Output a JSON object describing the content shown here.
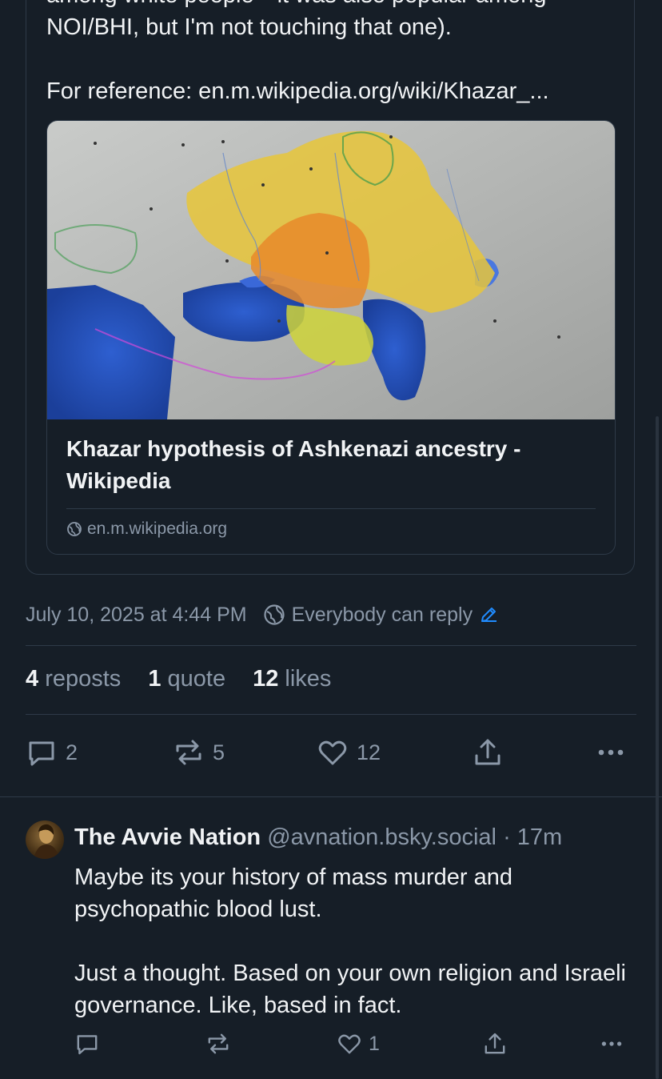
{
  "quote_post": {
    "clipped_line": "among white people—it was also popular among",
    "line1": "NOI/BHI, but I'm not touching that one).",
    "line2": "For reference: en.m.wikipedia.org/wiki/Khazar_...",
    "link_card": {
      "image_alt": "Map of the Khazar Khaganate",
      "title": "Khazar hypothesis of Ashkenazi ancestry - Wikipedia",
      "domain": "en.m.wikipedia.org"
    }
  },
  "meta": {
    "timestamp": "July 10, 2025 at 4:44 PM",
    "reply_setting": "Everybody can reply"
  },
  "stats": {
    "reposts_count": "4",
    "reposts_label": "reposts",
    "quotes_count": "1",
    "quotes_label": "quote",
    "likes_count": "12",
    "likes_label": "likes"
  },
  "actions": {
    "reply_count": "2",
    "repost_count": "5",
    "like_count": "12"
  },
  "reply": {
    "display_name": "The Avvie Nation",
    "handle": "@avnation.bsky.social",
    "time": "· 17m",
    "paragraph1": "Maybe its your history of mass murder and psychopathic blood lust.",
    "paragraph2": "Just a thought. Based on your own religion and Israeli governance. Like, based in fact.",
    "like_count": "1"
  },
  "colors": {
    "background": "#161e27",
    "border": "#2e3a48",
    "muted_text": "#8b98a8",
    "accent": "#208bfe"
  },
  "icons": [
    "globe-icon",
    "pencil-icon",
    "reply-icon",
    "repost-icon",
    "heart-icon",
    "share-icon",
    "more-icon"
  ]
}
